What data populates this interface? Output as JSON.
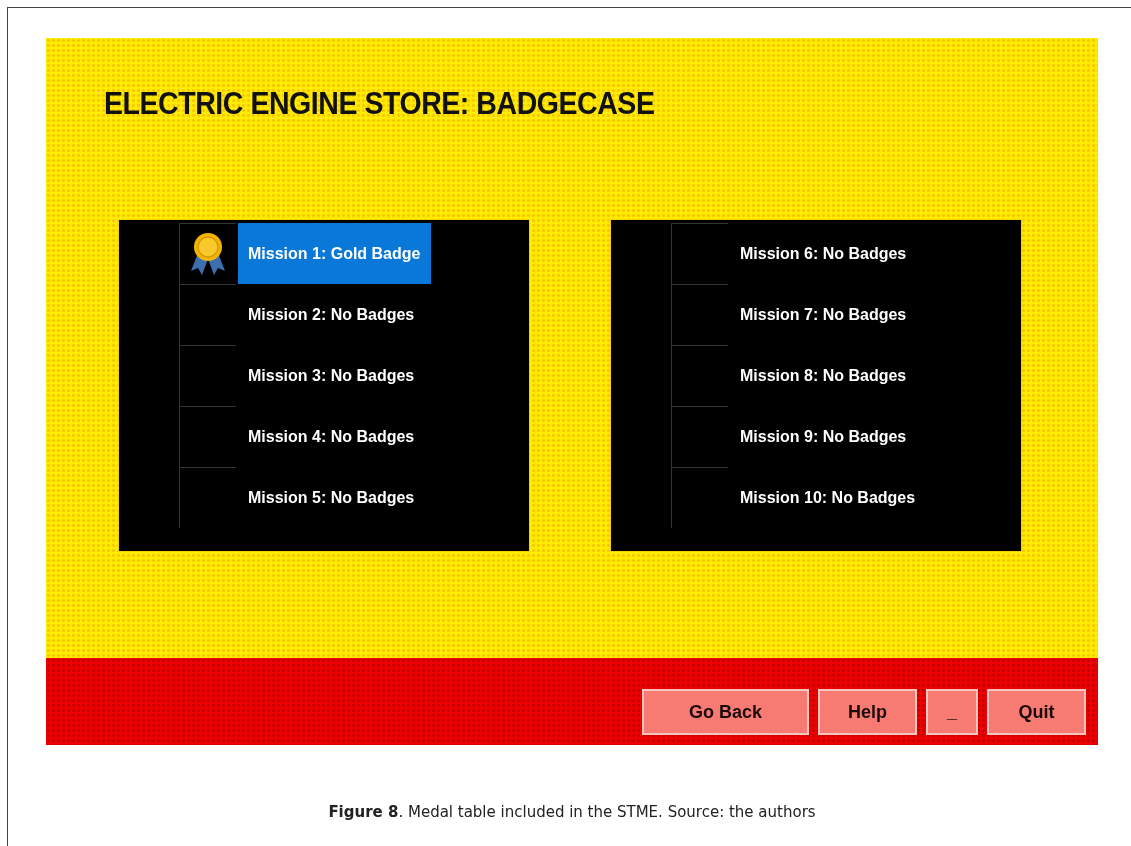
{
  "screen": {
    "title": "ELECTRIC ENGINE STORE: BADGECASE",
    "panels": [
      {
        "rows": [
          {
            "label": "Mission 1: Gold Badge",
            "kind": "medal",
            "selected": true
          },
          {
            "label": "Mission 2: No Badges",
            "kind": "empty",
            "selected": false
          },
          {
            "label": "Mission 3: No Badges",
            "kind": "empty",
            "selected": false
          },
          {
            "label": "Mission 4: No Badges",
            "kind": "empty",
            "selected": false
          },
          {
            "label": "Mission 5: No Badges",
            "kind": "empty",
            "selected": false
          }
        ]
      },
      {
        "rows": [
          {
            "label": "Mission 6: No Badges",
            "kind": "empty",
            "selected": false
          },
          {
            "label": "Mission 7: No Badges",
            "kind": "empty",
            "selected": false
          },
          {
            "label": "Mission 8: No Badges",
            "kind": "empty",
            "selected": false
          },
          {
            "label": "Mission 9: No Badges",
            "kind": "empty",
            "selected": false
          },
          {
            "label": "Mission 10: No Badges",
            "kind": "empty",
            "selected": false
          }
        ]
      }
    ],
    "buttons": [
      "Go Back",
      "Help",
      "_",
      "Quit"
    ]
  },
  "caption": "**Figure 8**. Medal table included in the STME. Source: the authors"
}
